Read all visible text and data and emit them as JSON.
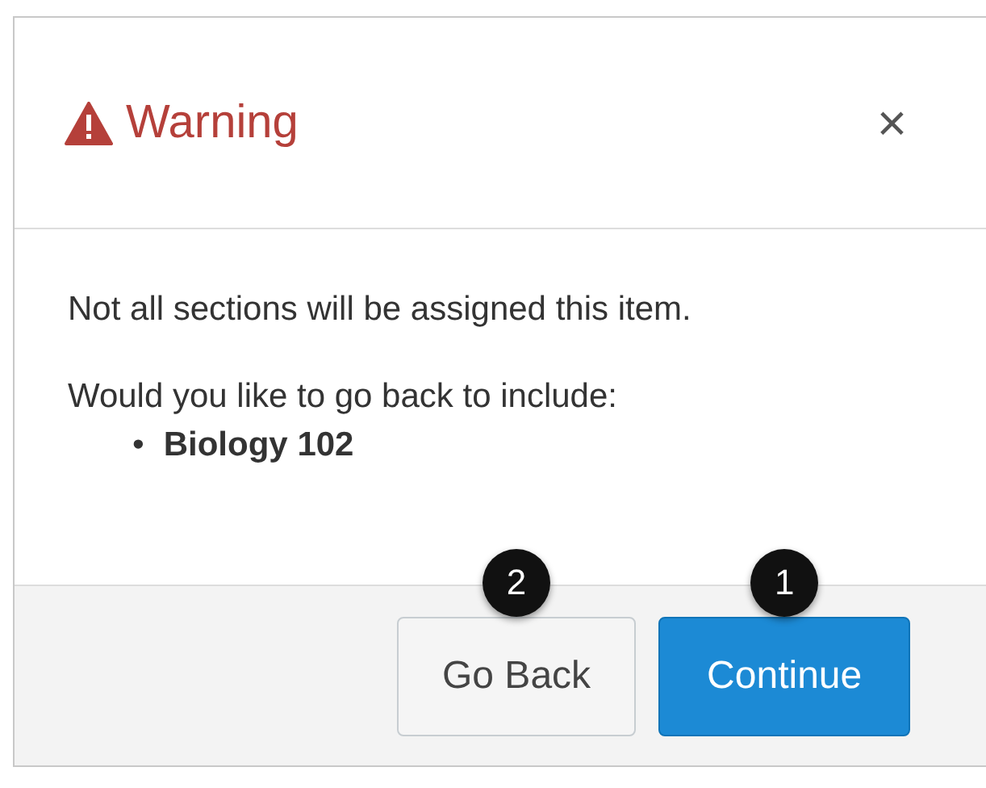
{
  "dialog": {
    "title": "Warning",
    "close": "×",
    "message": "Not all sections will be assigned this item.",
    "question": "Would you like to go back to include:",
    "items": [
      {
        "bullet": "•",
        "label": "Biology 102"
      }
    ],
    "buttons": [
      {
        "label": "Go Back",
        "kind": "secondary",
        "callout": "2"
      },
      {
        "label": "Continue",
        "kind": "primary",
        "callout": "1"
      }
    ]
  }
}
